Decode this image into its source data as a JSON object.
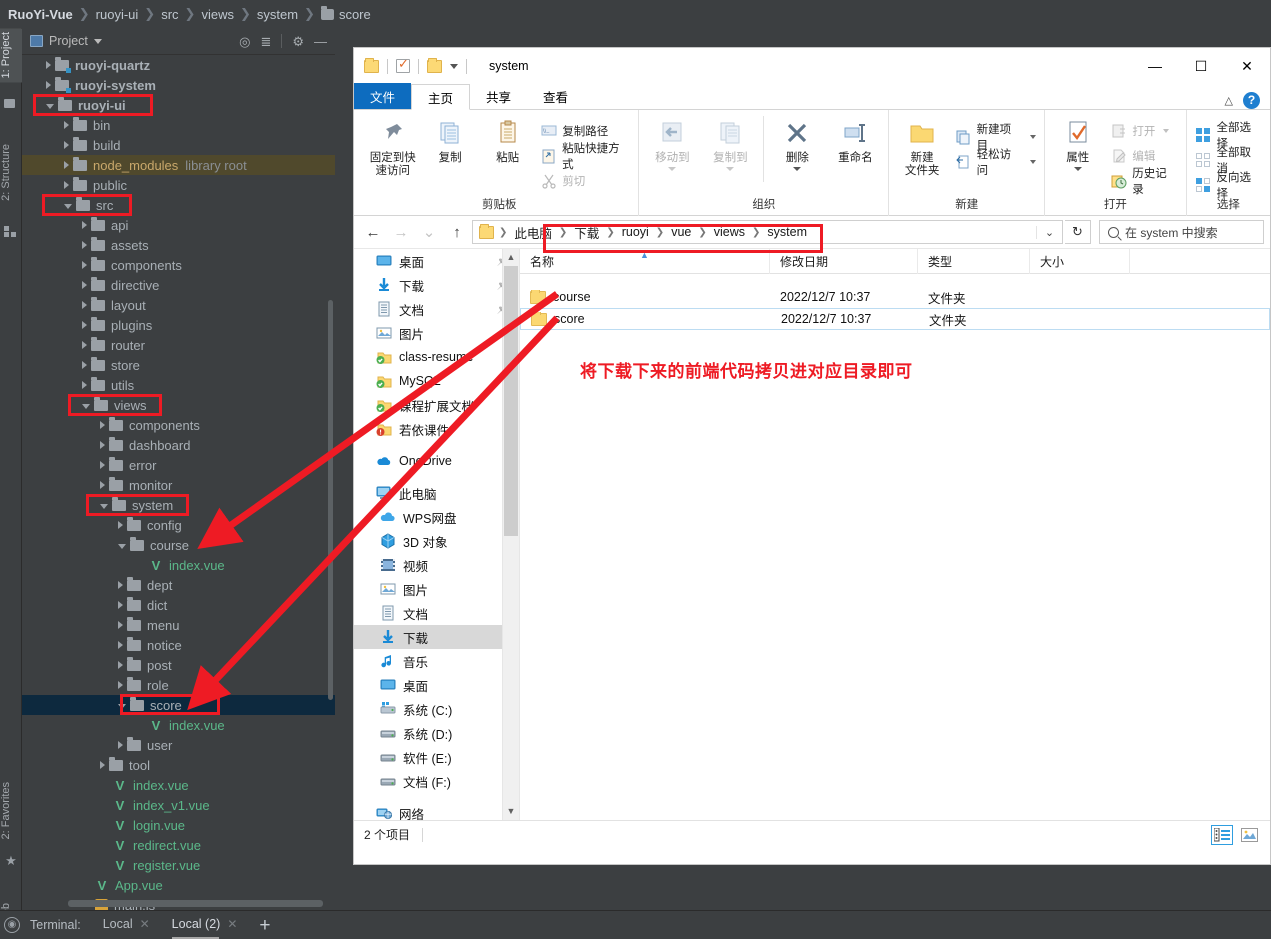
{
  "ide": {
    "breadcrumb": [
      {
        "label": "RuoYi-Vue",
        "bold": true
      },
      {
        "label": "ruoyi-ui",
        "bold": false
      },
      {
        "label": "src",
        "bold": false
      },
      {
        "label": "views",
        "bold": false
      },
      {
        "label": "system",
        "bold": false
      },
      {
        "label": "score",
        "bold": false,
        "folder": true
      }
    ],
    "panel_title": "Project",
    "left_tabs": [
      {
        "label": "1: Project",
        "active": true
      },
      {
        "label": "2: Structure",
        "active": false
      },
      {
        "label": "2: Favorites",
        "active": false
      },
      {
        "label": "Web",
        "active": false
      }
    ],
    "tree": [
      {
        "indent": 1,
        "arrow": "closed",
        "icon": "folder-module",
        "label": "ruoyi-quartz",
        "bold": true
      },
      {
        "indent": 1,
        "arrow": "closed",
        "icon": "folder-module",
        "label": "ruoyi-system",
        "bold": true
      },
      {
        "indent": 1,
        "arrow": "open",
        "icon": "folder",
        "label": "ruoyi-ui",
        "bold": true
      },
      {
        "indent": 2,
        "arrow": "closed",
        "icon": "folder",
        "label": "bin"
      },
      {
        "indent": 2,
        "arrow": "closed",
        "icon": "folder",
        "label": "build"
      },
      {
        "indent": 2,
        "arrow": "closed",
        "icon": "folder",
        "label": "node_modules",
        "sub": "library root",
        "style": "libroot"
      },
      {
        "indent": 2,
        "arrow": "closed",
        "icon": "folder",
        "label": "public"
      },
      {
        "indent": 2,
        "arrow": "open",
        "icon": "folder",
        "label": "src"
      },
      {
        "indent": 3,
        "arrow": "closed",
        "icon": "folder",
        "label": "api"
      },
      {
        "indent": 3,
        "arrow": "closed",
        "icon": "folder",
        "label": "assets"
      },
      {
        "indent": 3,
        "arrow": "closed",
        "icon": "folder",
        "label": "components"
      },
      {
        "indent": 3,
        "arrow": "closed",
        "icon": "folder",
        "label": "directive"
      },
      {
        "indent": 3,
        "arrow": "closed",
        "icon": "folder",
        "label": "layout"
      },
      {
        "indent": 3,
        "arrow": "closed",
        "icon": "folder",
        "label": "plugins"
      },
      {
        "indent": 3,
        "arrow": "closed",
        "icon": "folder",
        "label": "router"
      },
      {
        "indent": 3,
        "arrow": "closed",
        "icon": "folder",
        "label": "store"
      },
      {
        "indent": 3,
        "arrow": "closed",
        "icon": "folder",
        "label": "utils"
      },
      {
        "indent": 3,
        "arrow": "open",
        "icon": "folder",
        "label": "views"
      },
      {
        "indent": 4,
        "arrow": "closed",
        "icon": "folder",
        "label": "components"
      },
      {
        "indent": 4,
        "arrow": "closed",
        "icon": "folder",
        "label": "dashboard"
      },
      {
        "indent": 4,
        "arrow": "closed",
        "icon": "folder",
        "label": "error"
      },
      {
        "indent": 4,
        "arrow": "closed",
        "icon": "folder",
        "label": "monitor"
      },
      {
        "indent": 4,
        "arrow": "open",
        "icon": "folder",
        "label": "system"
      },
      {
        "indent": 5,
        "arrow": "closed",
        "icon": "folder",
        "label": "config"
      },
      {
        "indent": 5,
        "arrow": "open",
        "icon": "folder",
        "label": "course"
      },
      {
        "indent": 6,
        "arrow": "none",
        "icon": "vue",
        "label": "index.vue"
      },
      {
        "indent": 5,
        "arrow": "closed",
        "icon": "folder",
        "label": "dept"
      },
      {
        "indent": 5,
        "arrow": "closed",
        "icon": "folder",
        "label": "dict"
      },
      {
        "indent": 5,
        "arrow": "closed",
        "icon": "folder",
        "label": "menu"
      },
      {
        "indent": 5,
        "arrow": "closed",
        "icon": "folder",
        "label": "notice"
      },
      {
        "indent": 5,
        "arrow": "closed",
        "icon": "folder",
        "label": "post"
      },
      {
        "indent": 5,
        "arrow": "closed",
        "icon": "folder",
        "label": "role"
      },
      {
        "indent": 5,
        "arrow": "open",
        "icon": "folder",
        "label": "score",
        "style": "selected"
      },
      {
        "indent": 6,
        "arrow": "none",
        "icon": "vue",
        "label": "index.vue"
      },
      {
        "indent": 5,
        "arrow": "closed",
        "icon": "folder",
        "label": "user"
      },
      {
        "indent": 4,
        "arrow": "closed",
        "icon": "folder",
        "label": "tool"
      },
      {
        "indent": 4,
        "arrow": "none",
        "icon": "vue",
        "label": "index.vue"
      },
      {
        "indent": 4,
        "arrow": "none",
        "icon": "vue",
        "label": "index_v1.vue"
      },
      {
        "indent": 4,
        "arrow": "none",
        "icon": "vue",
        "label": "login.vue"
      },
      {
        "indent": 4,
        "arrow": "none",
        "icon": "vue",
        "label": "redirect.vue"
      },
      {
        "indent": 4,
        "arrow": "none",
        "icon": "vue",
        "label": "register.vue"
      },
      {
        "indent": 3,
        "arrow": "none",
        "icon": "vue",
        "label": "App.vue"
      },
      {
        "indent": 3,
        "arrow": "none",
        "icon": "js",
        "label": "main.js"
      }
    ],
    "bottom": {
      "terminal_label": "Terminal:",
      "tabs": [
        {
          "label": "Local",
          "active": false
        },
        {
          "label": "Local (2)",
          "active": true
        }
      ],
      "add_label": "+"
    }
  },
  "explorer": {
    "title": "system",
    "window_buttons": {
      "minimize": "—",
      "maximize": "☐",
      "close": "✕"
    },
    "tabs": [
      {
        "label": "文件",
        "style": "file"
      },
      {
        "label": "主页",
        "style": "active"
      },
      {
        "label": "共享",
        "style": "normal"
      },
      {
        "label": "查看",
        "style": "normal"
      }
    ],
    "help_tooltip": "?",
    "ribbon_groups": [
      {
        "name": "剪贴板",
        "big": [
          {
            "label": "固定到快\n速访问",
            "icon": "pin-icon",
            "disabled": false
          },
          {
            "label": "复制",
            "icon": "copy-icon",
            "disabled": false
          },
          {
            "label": "粘贴",
            "icon": "paste-icon",
            "disabled": false
          }
        ],
        "small": [
          {
            "label": "复制路径",
            "icon": "copy-path-icon",
            "disabled": false
          },
          {
            "label": "粘贴快捷方式",
            "icon": "paste-shortcut-icon",
            "disabled": false
          },
          {
            "label": "剪切",
            "icon": "cut-icon",
            "disabled": true
          }
        ]
      },
      {
        "name": "组织",
        "big": [
          {
            "label": "移动到",
            "icon": "move-to-icon",
            "disabled": true,
            "dropdown": true
          },
          {
            "label": "复制到",
            "icon": "copy-to-icon",
            "disabled": true,
            "dropdown": true
          },
          {
            "label": "删除",
            "icon": "delete-icon",
            "disabled": false,
            "dropdown": true
          },
          {
            "label": "重命名",
            "icon": "rename-icon",
            "disabled": false
          }
        ],
        "small": []
      },
      {
        "name": "新建",
        "big": [
          {
            "label": "新建\n文件夹",
            "icon": "new-folder-icon",
            "disabled": false
          }
        ],
        "small": [
          {
            "label": "新建项目",
            "icon": "new-item-icon",
            "disabled": false,
            "dropdown": true
          },
          {
            "label": "轻松访问",
            "icon": "easy-access-icon",
            "disabled": false,
            "dropdown": true
          }
        ]
      },
      {
        "name": "打开",
        "big": [
          {
            "label": "属性",
            "icon": "properties-icon",
            "disabled": false,
            "dropdown": true
          }
        ],
        "small": [
          {
            "label": "打开",
            "icon": "open-icon",
            "disabled": true,
            "dropdown": true
          },
          {
            "label": "编辑",
            "icon": "edit-icon",
            "disabled": true
          },
          {
            "label": "历史记录",
            "icon": "history-icon",
            "disabled": false
          }
        ]
      },
      {
        "name": "选择",
        "big": [],
        "small": [
          {
            "label": "全部选择",
            "icon": "select-all-icon",
            "disabled": false
          },
          {
            "label": "全部取消",
            "icon": "select-none-icon",
            "disabled": false
          },
          {
            "label": "反向选择",
            "icon": "invert-selection-icon",
            "disabled": false
          }
        ]
      }
    ],
    "address": {
      "back": "←",
      "forward": "→",
      "recent": "⌄",
      "up": "↑",
      "crumbs": [
        "此电脑",
        "下载",
        "ruoyi",
        "vue",
        "views",
        "system"
      ],
      "dropdown": "⌄",
      "refresh": "↻",
      "search_placeholder": "在 system 中搜索"
    },
    "nav_pane": [
      {
        "label": "桌面",
        "icon": "desktop-icon",
        "pinned": true,
        "level": 0
      },
      {
        "label": "下载",
        "icon": "downloads-icon",
        "pinned": true,
        "level": 0
      },
      {
        "label": "文档",
        "icon": "documents-icon",
        "pinned": true,
        "level": 0
      },
      {
        "label": "图片",
        "icon": "pictures-icon",
        "pinned": true,
        "level": 0
      },
      {
        "label": "class-resume",
        "icon": "synced-folder-icon",
        "level": 0
      },
      {
        "label": "MySQL",
        "icon": "synced-folder-icon",
        "level": 0
      },
      {
        "label": "课程扩展文档",
        "icon": "synced-folder-icon",
        "level": 0
      },
      {
        "label": "若依课件",
        "icon": "error-folder-icon",
        "level": 0
      },
      {
        "gap": true
      },
      {
        "label": "OneDrive",
        "icon": "onedrive-icon",
        "level": 0
      },
      {
        "gap": true
      },
      {
        "label": "此电脑",
        "icon": "this-pc-icon",
        "level": 0
      },
      {
        "label": "WPS网盘",
        "icon": "wps-cloud-icon",
        "level": 1
      },
      {
        "label": "3D 对象",
        "icon": "3d-objects-icon",
        "level": 1
      },
      {
        "label": "视频",
        "icon": "videos-icon",
        "level": 1
      },
      {
        "label": "图片",
        "icon": "pictures-icon",
        "level": 1
      },
      {
        "label": "文档",
        "icon": "documents-icon",
        "level": 1
      },
      {
        "label": "下载",
        "icon": "downloads-icon",
        "level": 1,
        "selected": true
      },
      {
        "label": "音乐",
        "icon": "music-icon",
        "level": 1
      },
      {
        "label": "桌面",
        "icon": "desktop-icon",
        "level": 1
      },
      {
        "label": "系统 (C:)",
        "icon": "system-drive-icon",
        "level": 1
      },
      {
        "label": "系统 (D:)",
        "icon": "drive-icon",
        "level": 1
      },
      {
        "label": "软件 (E:)",
        "icon": "drive-icon",
        "level": 1
      },
      {
        "label": "文档 (F:)",
        "icon": "drive-icon",
        "level": 1
      },
      {
        "gap": true
      },
      {
        "label": "网络",
        "icon": "network-icon",
        "level": 0
      }
    ],
    "file_list": {
      "columns": [
        "名称",
        "修改日期",
        "类型",
        "大小"
      ],
      "sorted_column": "名称",
      "rows": [
        {
          "name": "course",
          "modified": "2022/12/7 10:37",
          "type": "文件夹",
          "size": "",
          "selected": false
        },
        {
          "name": "score",
          "modified": "2022/12/7 10:37",
          "type": "文件夹",
          "size": "",
          "selected": true
        }
      ]
    },
    "status": {
      "item_count": "2 个项目"
    },
    "view_buttons": [
      {
        "name": "details-view",
        "active": true
      },
      {
        "name": "large-icons-view",
        "active": false
      }
    ]
  },
  "annotations": {
    "note_text": "将下载下来的前端代码拷贝进对应目录即可",
    "accent_color": "#ee1b24",
    "boxes": [
      "ruoyi-ui",
      "src",
      "views",
      "system",
      "score",
      "address-path"
    ],
    "arrows": [
      "course-arrow",
      "score-arrow"
    ]
  }
}
